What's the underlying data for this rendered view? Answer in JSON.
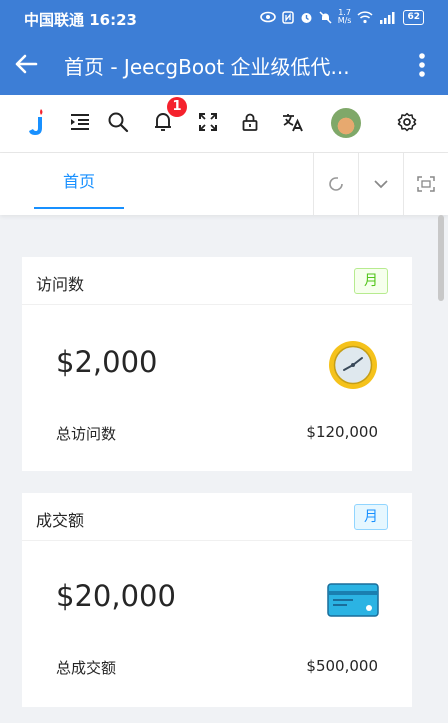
{
  "status_bar": {
    "carrier": "中国联通",
    "time": "16:23",
    "speed_value": "1.7",
    "speed_unit": "M/s",
    "battery": "62"
  },
  "app_bar": {
    "title": "首页 - JeecgBoot 企业级低代..."
  },
  "toolbar": {
    "notification_count": "1"
  },
  "tabs": [
    {
      "label": "首页",
      "active": true
    }
  ],
  "cards": [
    {
      "title": "访问数",
      "tag": "月",
      "tag_color": "green",
      "value": "$2,000",
      "footer_label": "总访问数",
      "footer_value": "$120,000",
      "icon": "clock-icon"
    },
    {
      "title": "成交额",
      "tag": "月",
      "tag_color": "blue",
      "value": "$20,000",
      "footer_label": "总成交额",
      "footer_value": "$500,000",
      "icon": "credit-card-icon"
    }
  ],
  "colors": {
    "app_bar": "#3d7ed6",
    "accent": "#1890ff",
    "badge": "#f5222d",
    "tag_green": "#52c41a"
  }
}
